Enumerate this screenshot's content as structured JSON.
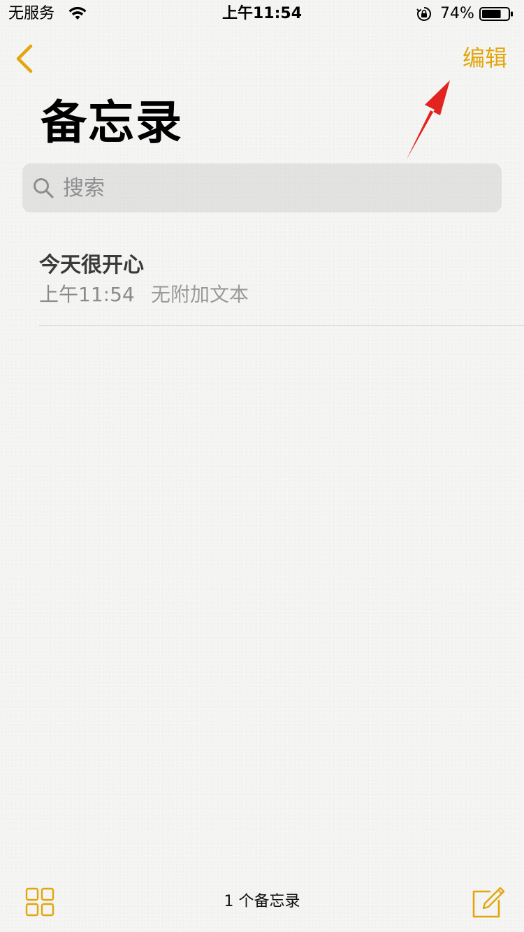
{
  "status_bar": {
    "carrier": "无服务",
    "time": "上午11:54",
    "battery_percent": "74%",
    "battery_level": 0.74
  },
  "nav": {
    "edit_label": "编辑"
  },
  "page": {
    "title": "备忘录"
  },
  "search": {
    "placeholder": "搜索",
    "value": ""
  },
  "notes": [
    {
      "title": "今天很开心",
      "time": "上午11:54",
      "preview": "无附加文本"
    }
  ],
  "toolbar": {
    "count_label": "1 个备忘录"
  },
  "icons": {
    "back": "chevron-left-icon",
    "search": "search-icon",
    "gallery": "grid-icon",
    "compose": "compose-icon",
    "wifi": "wifi-icon",
    "lock": "orientation-lock-icon",
    "battery": "battery-icon"
  },
  "colors": {
    "accent": "#e3a50c",
    "annotation_arrow": "#e3231f",
    "background": "#f4f4f3"
  }
}
